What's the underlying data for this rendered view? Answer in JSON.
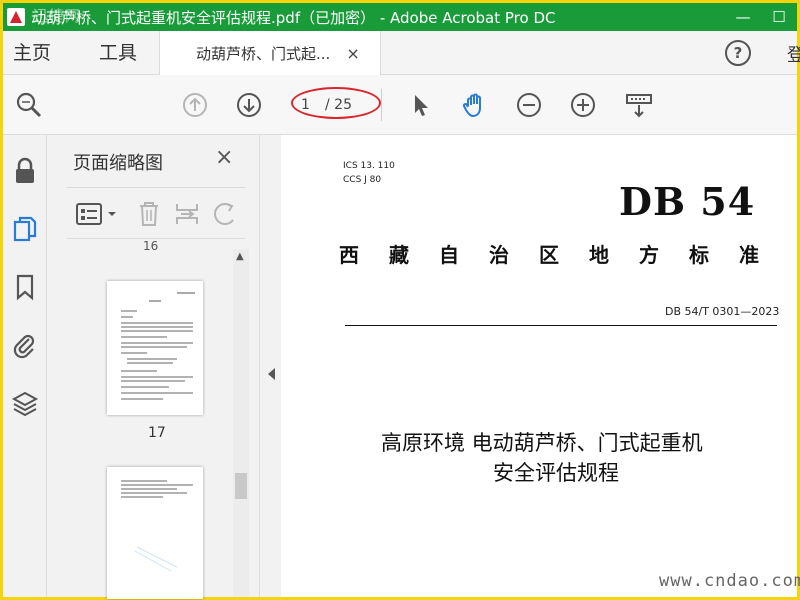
{
  "window": {
    "title": "动葫芦桥、门式起重机安全评估规程.pdf（已加密） - Adobe Acrobat Pro DC",
    "minimize_glyph": "—",
    "close_glyph": "☐",
    "watermark_logo": "迅捷网"
  },
  "menu": {
    "home": "主页",
    "tools": "工具",
    "tab_label": "动葫芦桥、门式起...",
    "tab_close": "×",
    "help": "?",
    "login": "登"
  },
  "toolbar": {
    "current_page": "1",
    "total_pages": "/ 25",
    "icons": [
      "zoom-icon",
      "page-up-icon",
      "page-down-icon",
      "select-cursor-icon",
      "hand-tool-icon",
      "zoom-out-icon",
      "zoom-in-icon",
      "scroll-mode-icon"
    ]
  },
  "panel": {
    "title": "页面缩略图",
    "close": "×",
    "partial_label": "16",
    "thumb_label_17": "17"
  },
  "document": {
    "ics": "ICS  13. 110",
    "ccs": "CCS  J  80",
    "standard_code": "DB 54",
    "region": "西藏自治区地方标准",
    "number": "DB 54/T  0301—2023",
    "title_line1": "高原环境  电动葫芦桥、门式起重机",
    "title_line2": "安全评估规程"
  },
  "watermark": {
    "site": "www.cndao.com"
  },
  "colors": {
    "titlebar": "#1a9b3a",
    "border": "#f5d40a",
    "annotation": "#d8262c",
    "accent_blue": "#2a7bd6"
  }
}
